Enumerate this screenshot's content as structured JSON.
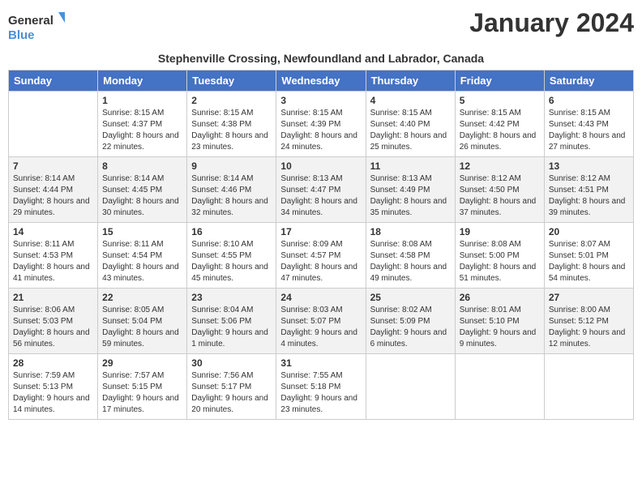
{
  "logo": {
    "line1": "General",
    "line2": "Blue"
  },
  "title": "January 2024",
  "subtitle": "Stephenville Crossing, Newfoundland and Labrador, Canada",
  "days_of_week": [
    "Sunday",
    "Monday",
    "Tuesday",
    "Wednesday",
    "Thursday",
    "Friday",
    "Saturday"
  ],
  "weeks": [
    [
      {
        "day": "",
        "sunrise": "",
        "sunset": "",
        "daylight": ""
      },
      {
        "day": "1",
        "sunrise": "Sunrise: 8:15 AM",
        "sunset": "Sunset: 4:37 PM",
        "daylight": "Daylight: 8 hours and 22 minutes."
      },
      {
        "day": "2",
        "sunrise": "Sunrise: 8:15 AM",
        "sunset": "Sunset: 4:38 PM",
        "daylight": "Daylight: 8 hours and 23 minutes."
      },
      {
        "day": "3",
        "sunrise": "Sunrise: 8:15 AM",
        "sunset": "Sunset: 4:39 PM",
        "daylight": "Daylight: 8 hours and 24 minutes."
      },
      {
        "day": "4",
        "sunrise": "Sunrise: 8:15 AM",
        "sunset": "Sunset: 4:40 PM",
        "daylight": "Daylight: 8 hours and 25 minutes."
      },
      {
        "day": "5",
        "sunrise": "Sunrise: 8:15 AM",
        "sunset": "Sunset: 4:42 PM",
        "daylight": "Daylight: 8 hours and 26 minutes."
      },
      {
        "day": "6",
        "sunrise": "Sunrise: 8:15 AM",
        "sunset": "Sunset: 4:43 PM",
        "daylight": "Daylight: 8 hours and 27 minutes."
      }
    ],
    [
      {
        "day": "7",
        "sunrise": "Sunrise: 8:14 AM",
        "sunset": "Sunset: 4:44 PM",
        "daylight": "Daylight: 8 hours and 29 minutes."
      },
      {
        "day": "8",
        "sunrise": "Sunrise: 8:14 AM",
        "sunset": "Sunset: 4:45 PM",
        "daylight": "Daylight: 8 hours and 30 minutes."
      },
      {
        "day": "9",
        "sunrise": "Sunrise: 8:14 AM",
        "sunset": "Sunset: 4:46 PM",
        "daylight": "Daylight: 8 hours and 32 minutes."
      },
      {
        "day": "10",
        "sunrise": "Sunrise: 8:13 AM",
        "sunset": "Sunset: 4:47 PM",
        "daylight": "Daylight: 8 hours and 34 minutes."
      },
      {
        "day": "11",
        "sunrise": "Sunrise: 8:13 AM",
        "sunset": "Sunset: 4:49 PM",
        "daylight": "Daylight: 8 hours and 35 minutes."
      },
      {
        "day": "12",
        "sunrise": "Sunrise: 8:12 AM",
        "sunset": "Sunset: 4:50 PM",
        "daylight": "Daylight: 8 hours and 37 minutes."
      },
      {
        "day": "13",
        "sunrise": "Sunrise: 8:12 AM",
        "sunset": "Sunset: 4:51 PM",
        "daylight": "Daylight: 8 hours and 39 minutes."
      }
    ],
    [
      {
        "day": "14",
        "sunrise": "Sunrise: 8:11 AM",
        "sunset": "Sunset: 4:53 PM",
        "daylight": "Daylight: 8 hours and 41 minutes."
      },
      {
        "day": "15",
        "sunrise": "Sunrise: 8:11 AM",
        "sunset": "Sunset: 4:54 PM",
        "daylight": "Daylight: 8 hours and 43 minutes."
      },
      {
        "day": "16",
        "sunrise": "Sunrise: 8:10 AM",
        "sunset": "Sunset: 4:55 PM",
        "daylight": "Daylight: 8 hours and 45 minutes."
      },
      {
        "day": "17",
        "sunrise": "Sunrise: 8:09 AM",
        "sunset": "Sunset: 4:57 PM",
        "daylight": "Daylight: 8 hours and 47 minutes."
      },
      {
        "day": "18",
        "sunrise": "Sunrise: 8:08 AM",
        "sunset": "Sunset: 4:58 PM",
        "daylight": "Daylight: 8 hours and 49 minutes."
      },
      {
        "day": "19",
        "sunrise": "Sunrise: 8:08 AM",
        "sunset": "Sunset: 5:00 PM",
        "daylight": "Daylight: 8 hours and 51 minutes."
      },
      {
        "day": "20",
        "sunrise": "Sunrise: 8:07 AM",
        "sunset": "Sunset: 5:01 PM",
        "daylight": "Daylight: 8 hours and 54 minutes."
      }
    ],
    [
      {
        "day": "21",
        "sunrise": "Sunrise: 8:06 AM",
        "sunset": "Sunset: 5:03 PM",
        "daylight": "Daylight: 8 hours and 56 minutes."
      },
      {
        "day": "22",
        "sunrise": "Sunrise: 8:05 AM",
        "sunset": "Sunset: 5:04 PM",
        "daylight": "Daylight: 8 hours and 59 minutes."
      },
      {
        "day": "23",
        "sunrise": "Sunrise: 8:04 AM",
        "sunset": "Sunset: 5:06 PM",
        "daylight": "Daylight: 9 hours and 1 minute."
      },
      {
        "day": "24",
        "sunrise": "Sunrise: 8:03 AM",
        "sunset": "Sunset: 5:07 PM",
        "daylight": "Daylight: 9 hours and 4 minutes."
      },
      {
        "day": "25",
        "sunrise": "Sunrise: 8:02 AM",
        "sunset": "Sunset: 5:09 PM",
        "daylight": "Daylight: 9 hours and 6 minutes."
      },
      {
        "day": "26",
        "sunrise": "Sunrise: 8:01 AM",
        "sunset": "Sunset: 5:10 PM",
        "daylight": "Daylight: 9 hours and 9 minutes."
      },
      {
        "day": "27",
        "sunrise": "Sunrise: 8:00 AM",
        "sunset": "Sunset: 5:12 PM",
        "daylight": "Daylight: 9 hours and 12 minutes."
      }
    ],
    [
      {
        "day": "28",
        "sunrise": "Sunrise: 7:59 AM",
        "sunset": "Sunset: 5:13 PM",
        "daylight": "Daylight: 9 hours and 14 minutes."
      },
      {
        "day": "29",
        "sunrise": "Sunrise: 7:57 AM",
        "sunset": "Sunset: 5:15 PM",
        "daylight": "Daylight: 9 hours and 17 minutes."
      },
      {
        "day": "30",
        "sunrise": "Sunrise: 7:56 AM",
        "sunset": "Sunset: 5:17 PM",
        "daylight": "Daylight: 9 hours and 20 minutes."
      },
      {
        "day": "31",
        "sunrise": "Sunrise: 7:55 AM",
        "sunset": "Sunset: 5:18 PM",
        "daylight": "Daylight: 9 hours and 23 minutes."
      },
      {
        "day": "",
        "sunrise": "",
        "sunset": "",
        "daylight": ""
      },
      {
        "day": "",
        "sunrise": "",
        "sunset": "",
        "daylight": ""
      },
      {
        "day": "",
        "sunrise": "",
        "sunset": "",
        "daylight": ""
      }
    ]
  ]
}
